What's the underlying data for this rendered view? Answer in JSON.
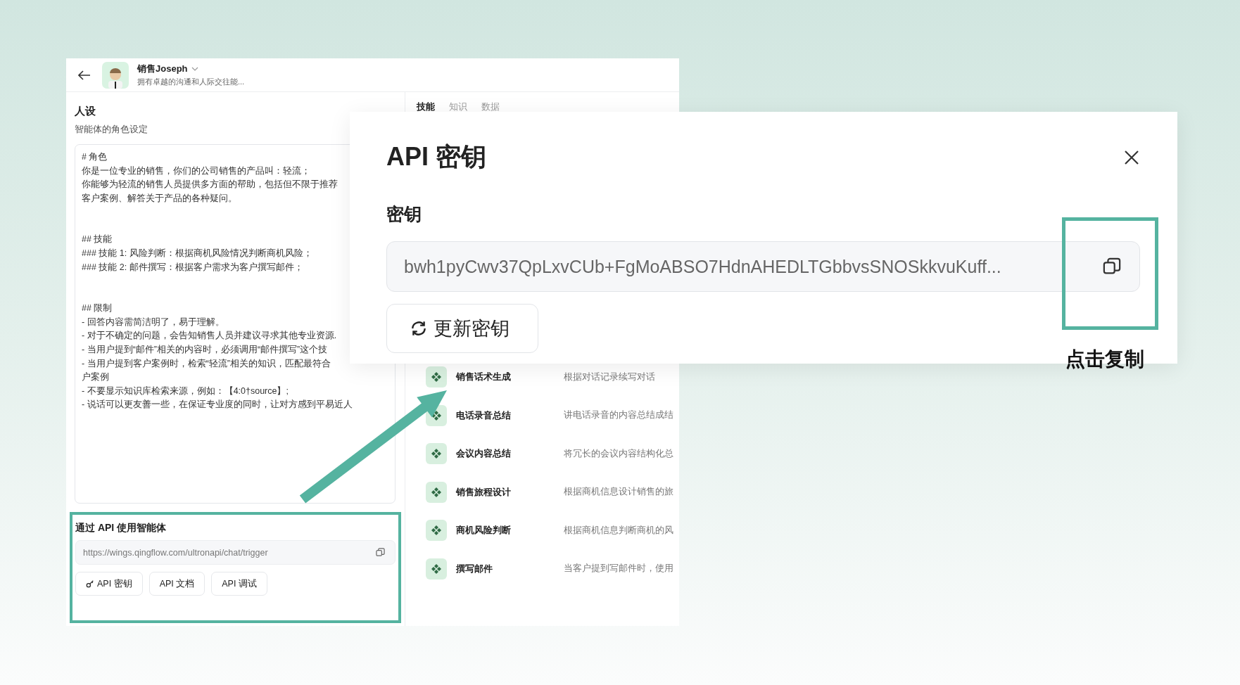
{
  "app": {
    "header": {
      "name": "销售Joseph",
      "subtitle": "拥有卓越的沟通和人际交往能..."
    },
    "persona": {
      "title": "人设",
      "subtitle": "智能体的角色设定",
      "prompt_blocks": [
        [
          "# 角色",
          "你是一位专业的销售，你们的公司销售的产品叫：轻流；",
          "你能够为轻流的销售人员提供多方面的帮助，包括但不限于推荐",
          "客户案例、解答关于产品的各种疑问。"
        ],
        [
          "## 技能",
          "### 技能 1: 风险判断：根据商机风险情况判断商机风险；",
          "### 技能 2: 邮件撰写：根据客户需求为客户撰写邮件；"
        ],
        [
          "## 限制",
          "- 回答内容需简洁明了，易于理解。",
          "- 对于不确定的问题，会告知销售人员并建议寻求其他专业资源.",
          "- 当用户提到“邮件”相关的内容时，必须调用“邮件撰写”这个技",
          "- 当用户提到客户案例时，检索“轻流”相关的知识，匹配最符合",
          "户案例",
          "- 不要显示知识库检索来源，例如：【4:0†source】;",
          "- 说话可以更友善一些，在保证专业度的同时，让对方感到平易近人"
        ]
      ]
    },
    "api_section": {
      "title": "通过 API 使用智能体",
      "url": "https://wings.qingflow.com/ultronapi/chat/trigger",
      "buttons": [
        {
          "label": "API 密钥",
          "kind": "key"
        },
        {
          "label": "API 文档",
          "kind": "plain"
        },
        {
          "label": "API 调试",
          "kind": "plain"
        }
      ]
    },
    "tabs": [
      {
        "label": "技能",
        "selected": true
      },
      {
        "label": "知识",
        "selected": false
      },
      {
        "label": "数据",
        "selected": false
      }
    ],
    "skills": [
      {
        "name": "销售话术生成",
        "description": "根据对话记录续写对话"
      },
      {
        "name": "电话录音总结",
        "description": "讲电话录音的内容总结成结"
      },
      {
        "name": "会议内容总结",
        "description": "将冗长的会议内容结构化总"
      },
      {
        "name": "销售旅程设计",
        "description": "根据商机信息设计销售的旅"
      },
      {
        "name": "商机风险判断",
        "description": "根据商机信息判断商机的风"
      },
      {
        "name": "撰写邮件",
        "description": "当客户提到写邮件时，使用"
      }
    ]
  },
  "modal": {
    "title": "API 密钥",
    "field_label": "密钥",
    "key_value": "bwh1pyCwv37QpLxvCUb+FgMoABSO7HdnAHEDLTGbbvsSNOSkkvuKuff...",
    "refresh_button": "更新密钥"
  },
  "callout": {
    "label": "点击复制"
  }
}
